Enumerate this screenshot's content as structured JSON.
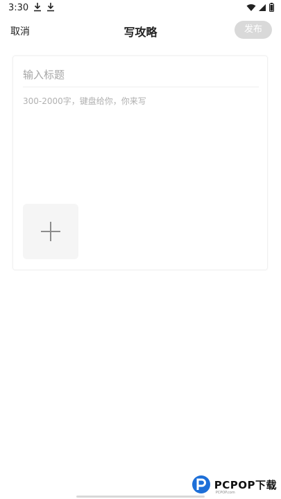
{
  "status_bar": {
    "time": "3:30",
    "icons": [
      "download-icon",
      "download-icon",
      "wifi-icon",
      "signal-icon",
      "battery-icon"
    ]
  },
  "top_bar": {
    "cancel_label": "取消",
    "title": "写攻略",
    "publish_label": "发布"
  },
  "editor": {
    "title_placeholder": "输入标题",
    "title_value": "",
    "body_placeholder": "300-2000字，键盘给你，你来写",
    "body_value": "",
    "add_image_icon": "plus-icon"
  },
  "watermark": {
    "text": "PCPOP下载",
    "subtext": "PCPOP.com"
  },
  "colors": {
    "publish_bg": "#d9d9d9",
    "placeholder": "#a6a6a6",
    "watermark_blue": "#1d6fd8"
  }
}
